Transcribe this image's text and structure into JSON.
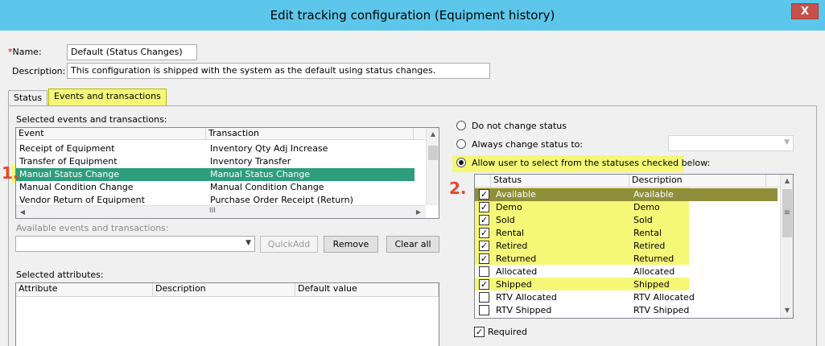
{
  "window": {
    "title": "Edit tracking configuration (Equipment history)",
    "close_glyph": "X"
  },
  "form": {
    "name_required_mark": "*",
    "name_label": "Name:",
    "name_value": "Default (Status Changes)",
    "description_label": "Description:",
    "description_value": "This configuration is shipped with the system as the default using status changes."
  },
  "tabs": [
    {
      "label": "Status",
      "active": false
    },
    {
      "label": "Events and transactions",
      "active": true
    }
  ],
  "events": {
    "section_label": "Selected events and transactions:",
    "columns": [
      "Event",
      "Transaction"
    ],
    "rows": [
      {
        "event": "Receipt of Equipment",
        "transaction": "Inventory Qty Adj Increase",
        "selected": false
      },
      {
        "event": "Transfer of Equipment",
        "transaction": "Inventory Transfer",
        "selected": false
      },
      {
        "event": "Manual Status Change",
        "transaction": "Manual Status Change",
        "selected": true
      },
      {
        "event": "Manual Condition Change",
        "transaction": "Manual Condition Change",
        "selected": false
      },
      {
        "event": "Vendor Return of Equipment",
        "transaction": "Purchase Order Receipt (Return)",
        "selected": false
      }
    ],
    "hscroll_grip": "III",
    "available_label": "Available events and transactions:",
    "available_value": ""
  },
  "buttons": {
    "quickadd": "QuickAdd",
    "remove": "Remove",
    "clear_all": "Clear all"
  },
  "attributes": {
    "section_label": "Selected attributes:",
    "columns": [
      "Attribute",
      "Description",
      "Default value"
    ]
  },
  "status_options": {
    "do_not_change": "Do not change status",
    "always_change": "Always change status to:",
    "always_change_value": "",
    "allow_select": "Allow user to select from the statuses checked below:",
    "selected_option": "allow_select"
  },
  "statuses": {
    "columns": [
      "Status",
      "Description"
    ],
    "rows": [
      {
        "status": "Available",
        "description": "Available",
        "checked": true,
        "selected": true
      },
      {
        "status": "Demo",
        "description": "Demo",
        "checked": true,
        "selected": false
      },
      {
        "status": "Sold",
        "description": "Sold",
        "checked": true,
        "selected": false
      },
      {
        "status": "Rental",
        "description": "Rental",
        "checked": true,
        "selected": false
      },
      {
        "status": "Retired",
        "description": "Retired",
        "checked": true,
        "selected": false
      },
      {
        "status": "Returned",
        "description": "Returned",
        "checked": true,
        "selected": false
      },
      {
        "status": "Allocated",
        "description": "Allocated",
        "checked": false,
        "selected": false
      },
      {
        "status": "Shipped",
        "description": "Shipped",
        "checked": true,
        "selected": false
      },
      {
        "status": "RTV Allocated",
        "description": "RTV Allocated",
        "checked": false,
        "selected": false
      },
      {
        "status": "RTV Shipped",
        "description": "RTV Shipped",
        "checked": false,
        "selected": false
      }
    ],
    "scroll_grip": "≡"
  },
  "required": {
    "label": "Required",
    "checked": true
  },
  "markers": {
    "one": "1.",
    "two": "2."
  },
  "colors": {
    "titlebar": "#5cc7ea",
    "highlight": "#f5f877",
    "selected_row": "#2e9d7b",
    "marker": "#e8462a"
  }
}
